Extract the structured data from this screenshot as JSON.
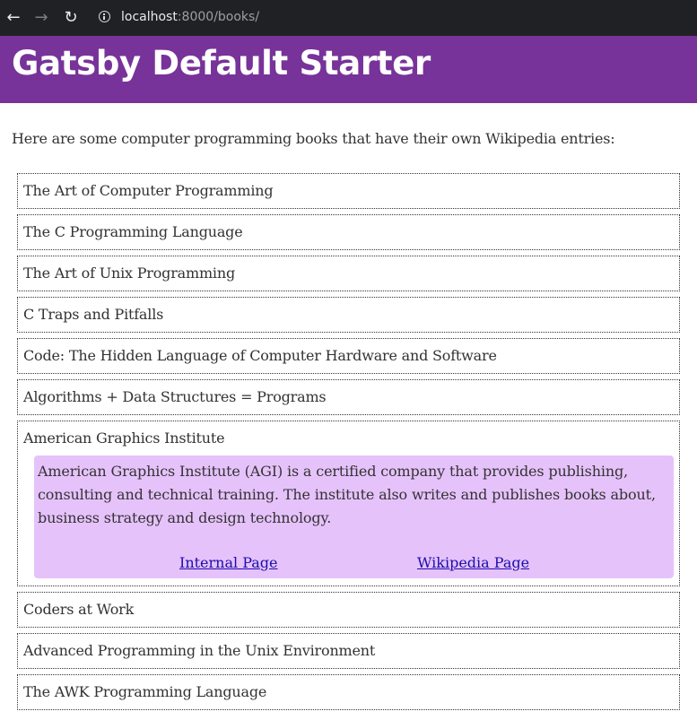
{
  "browser": {
    "back_icon": "arrow-left-icon",
    "forward_icon": "arrow-right-icon",
    "reload_icon": "reload-icon",
    "info_icon": "info-icon",
    "url_host": "localhost",
    "url_rest": ":8000/books/"
  },
  "header": {
    "title": "Gatsby Default Starter",
    "background_color": "#773399"
  },
  "main": {
    "intro": "Here are some computer programming books that have their own Wikipedia entries:",
    "books": [
      {
        "title": "The Art of Computer Programming"
      },
      {
        "title": "The C Programming Language"
      },
      {
        "title": "The Art of Unix Programming"
      },
      {
        "title": "C Traps and Pitfalls"
      },
      {
        "title": "Code: The Hidden Language of Computer Hardware and Software"
      },
      {
        "title": "Algorithms + Data Structures = Programs"
      },
      {
        "title": "American Graphics Institute",
        "expanded": true,
        "description": "American Graphics Institute (AGI) is a certified company that provides publishing, consulting and technical training. The institute also writes and publishes books about, business strategy and design technology.",
        "internal_link": "Internal Page",
        "wikipedia_link": "Wikipedia Page"
      },
      {
        "title": "Coders at Work"
      },
      {
        "title": "Advanced Programming in the Unix Environment"
      },
      {
        "title": "The AWK Programming Language"
      }
    ],
    "panel_color": "#e6c2fb",
    "link_color": "#1a0dab"
  }
}
